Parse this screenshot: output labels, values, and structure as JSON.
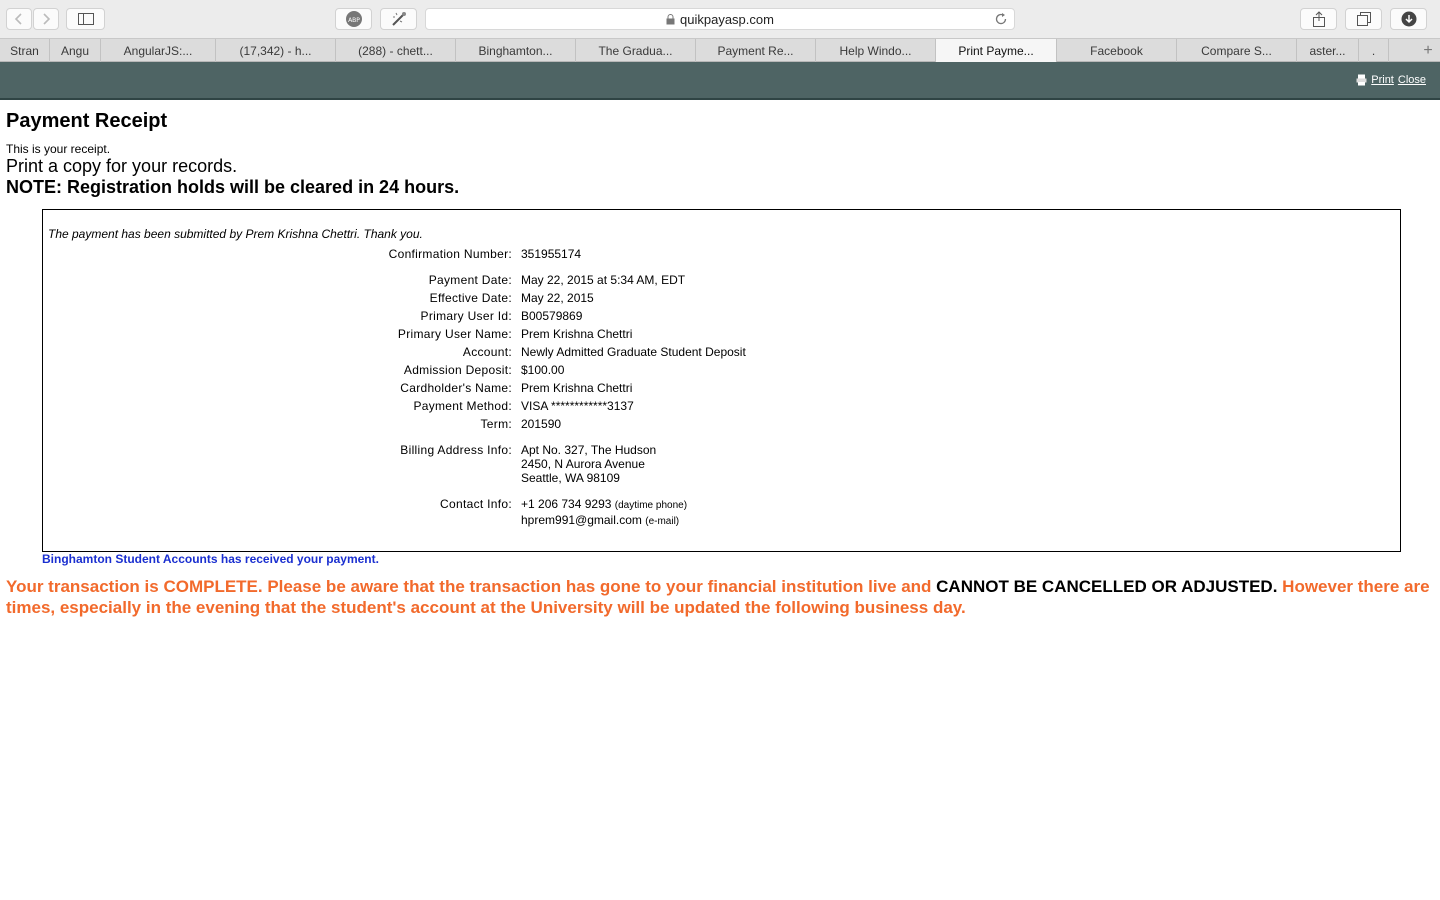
{
  "browser": {
    "url": "quikpayasp.com",
    "tabs": [
      {
        "label": "Stran"
      },
      {
        "label": "Angu"
      },
      {
        "label": "AngularJS:..."
      },
      {
        "label": "(17,342) - h..."
      },
      {
        "label": "(288) - chett..."
      },
      {
        "label": "Binghamton..."
      },
      {
        "label": "The Gradua..."
      },
      {
        "label": "Payment Re..."
      },
      {
        "label": "Help Windo..."
      },
      {
        "label": "Print Payme..."
      },
      {
        "label": "Facebook"
      },
      {
        "label": "Compare S..."
      },
      {
        "label": "aster..."
      },
      {
        "label": "."
      }
    ],
    "new_tab": "+"
  },
  "printbar": {
    "print_label": "Print",
    "close_label": "Close"
  },
  "receipt": {
    "title": "Payment Receipt",
    "intro": "This is your receipt.",
    "print_copy": "Print a copy for your records.",
    "note": "NOTE: Registration holds will be cleared in 24 hours.",
    "submitted_msg": "The payment has been submitted by Prem Krishna Chettri. Thank you.",
    "fields": {
      "confirmation": {
        "label": "Confirmation Number:",
        "value": "351955174"
      },
      "payment_date": {
        "label": "Payment Date:",
        "value": "May 22, 2015 at 5:34 AM, EDT"
      },
      "effective_date": {
        "label": "Effective Date:",
        "value": "May 22, 2015"
      },
      "user_id": {
        "label": "Primary User Id:",
        "value": "B00579869"
      },
      "user_name": {
        "label": "Primary User Name:",
        "value": "Prem Krishna Chettri"
      },
      "account": {
        "label": "Account:",
        "value": "Newly Admitted Graduate Student Deposit"
      },
      "deposit": {
        "label": "Admission Deposit:",
        "value": "$100.00"
      },
      "cardholder": {
        "label": "Cardholder's Name:",
        "value": "Prem Krishna Chettri"
      },
      "method": {
        "label": "Payment Method:",
        "value": "VISA ************3137"
      },
      "term": {
        "label": "Term:",
        "value": "201590"
      },
      "billing": {
        "label": "Billing Address Info:",
        "line1": "Apt No. 327, The Hudson",
        "line2": "2450, N Aurora Avenue",
        "line3": "Seattle, WA 98109"
      },
      "contact": {
        "label": "Contact Info:",
        "phone": "+1 206 734 9293",
        "phone_note": "(daytime phone)",
        "email": "hprem991@gmail.com",
        "email_note": "(e-mail)"
      }
    },
    "received_msg": "Binghamton Student Accounts has received your payment.",
    "final_part1": "Your transaction is COMPLETE. Please be aware that the transaction has gone to your financial institution live and",
    "final_part2": "CANNOT BE CANCELLED OR ADJUSTED.",
    "final_part3": "However there are times, especially in the evening that the student's account at the University will be updated the following business day."
  },
  "colors": {
    "printbar": "#4e6464",
    "received": "#1a2fd0",
    "warning": "#f26a2c"
  }
}
